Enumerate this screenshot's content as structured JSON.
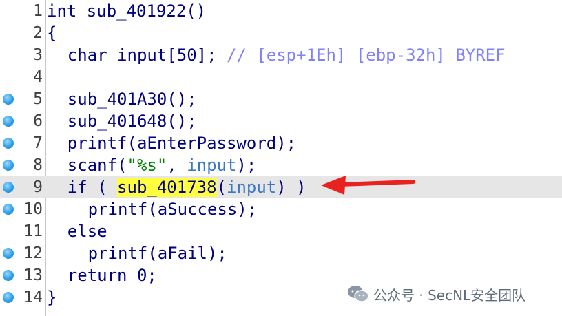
{
  "lines": [
    {
      "no": "1",
      "bp": false,
      "hl": false,
      "indent": 0,
      "tokens": [
        {
          "t": "int sub_401922()",
          "c": ""
        }
      ]
    },
    {
      "no": "2",
      "bp": false,
      "hl": false,
      "indent": 0,
      "tokens": [
        {
          "t": "{",
          "c": ""
        }
      ]
    },
    {
      "no": "3",
      "bp": false,
      "hl": false,
      "indent": 2,
      "tokens": [
        {
          "t": "char input[50]; ",
          "c": ""
        },
        {
          "t": "// [esp+1Eh] [ebp-32h] BYREF",
          "c": "cmt"
        }
      ]
    },
    {
      "no": "4",
      "bp": false,
      "hl": false,
      "indent": 0,
      "tokens": []
    },
    {
      "no": "5",
      "bp": true,
      "hl": false,
      "indent": 2,
      "tokens": [
        {
          "t": "sub_401A30();",
          "c": ""
        }
      ]
    },
    {
      "no": "6",
      "bp": true,
      "hl": false,
      "indent": 2,
      "tokens": [
        {
          "t": "sub_401648();",
          "c": ""
        }
      ]
    },
    {
      "no": "7",
      "bp": true,
      "hl": false,
      "indent": 2,
      "tokens": [
        {
          "t": "printf(aEnterPassword);",
          "c": ""
        }
      ]
    },
    {
      "no": "8",
      "bp": true,
      "hl": false,
      "indent": 2,
      "tokens": [
        {
          "t": "scanf(",
          "c": ""
        },
        {
          "t": "\"%s\"",
          "c": "str"
        },
        {
          "t": ", ",
          "c": ""
        },
        {
          "t": "input",
          "c": "var"
        },
        {
          "t": ");",
          "c": ""
        }
      ]
    },
    {
      "no": "9",
      "bp": true,
      "hl": true,
      "indent": 2,
      "tokens": [
        {
          "t": "if ( ",
          "c": ""
        },
        {
          "t": "sub_401738",
          "c": "sel"
        },
        {
          "t": "(",
          "c": ""
        },
        {
          "t": "input",
          "c": "var"
        },
        {
          "t": ") )",
          "c": ""
        }
      ]
    },
    {
      "no": "10",
      "bp": true,
      "hl": false,
      "indent": 4,
      "tokens": [
        {
          "t": "printf(aSuccess);",
          "c": ""
        }
      ]
    },
    {
      "no": "11",
      "bp": false,
      "hl": false,
      "indent": 2,
      "tokens": [
        {
          "t": "else",
          "c": ""
        }
      ]
    },
    {
      "no": "12",
      "bp": true,
      "hl": false,
      "indent": 4,
      "tokens": [
        {
          "t": "printf(aFail);",
          "c": ""
        }
      ]
    },
    {
      "no": "13",
      "bp": true,
      "hl": false,
      "indent": 2,
      "tokens": [
        {
          "t": "return 0;",
          "c": ""
        }
      ]
    },
    {
      "no": "14",
      "bp": true,
      "hl": false,
      "indent": 0,
      "tokens": [
        {
          "t": "}",
          "c": ""
        }
      ]
    }
  ],
  "watermark": {
    "text": "公众号 · SecNL安全团队",
    "icon": "wechat-icon"
  },
  "colors": {
    "keyword_text": "#000080",
    "comment": "#8080ff",
    "string": "#008000",
    "variable": "#3c78c8",
    "selection": "#ffff40",
    "current_line": "#e6e6e6",
    "breakpoint": "#2f9ee8",
    "arrow": "#e8231f"
  }
}
